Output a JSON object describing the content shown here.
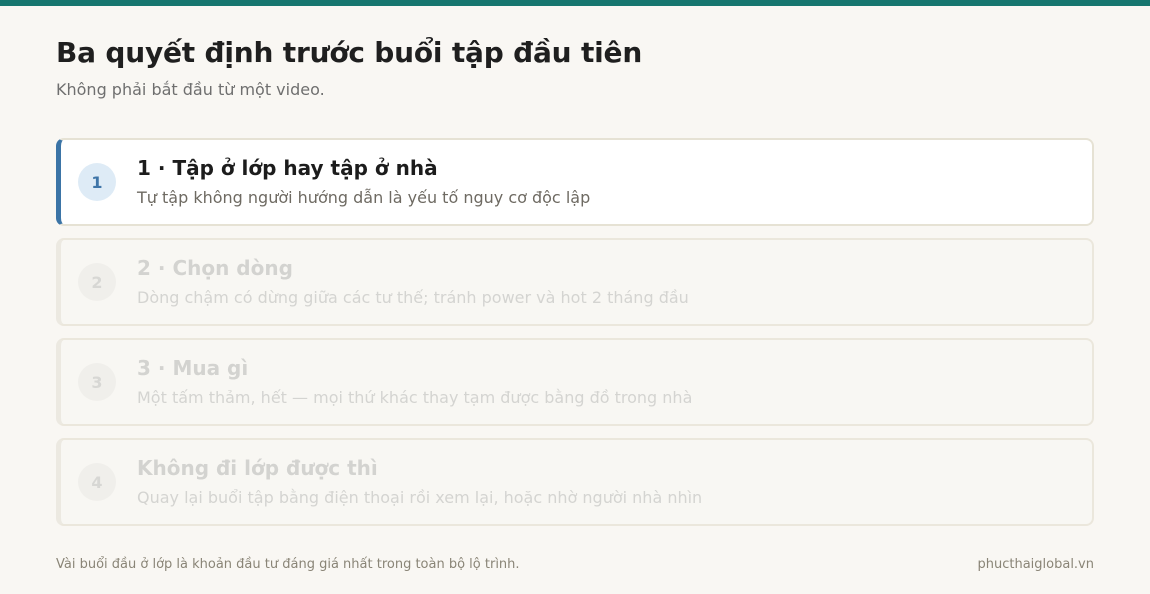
{
  "colors": {
    "accent_bar": "#17766f",
    "active_border": "#3b74a6",
    "background": "#f9f7f3"
  },
  "header": {
    "title": "Ba quyết định trước buổi tập đầu tiên",
    "subtitle": "Không phải bắt đầu từ một video."
  },
  "steps": [
    {
      "number": "1",
      "title": "1 · Tập ở lớp hay tập ở nhà",
      "description": "Tự tập không người hướng dẫn là yếu tố nguy cơ độc lập",
      "state": "active"
    },
    {
      "number": "2",
      "title": "2 · Chọn dòng",
      "description": "Dòng chậm có dừng giữa các tư thế; tránh power và hot 2 tháng đầu",
      "state": "inactive"
    },
    {
      "number": "3",
      "title": "3 · Mua gì",
      "description": "Một tấm thảm, hết — mọi thứ khác thay tạm được bằng đồ trong nhà",
      "state": "inactive"
    },
    {
      "number": "4",
      "title": "Không đi lớp được thì",
      "description": "Quay lại buổi tập bằng điện thoại rồi xem lại, hoặc nhờ người nhà nhìn",
      "state": "inactive"
    }
  ],
  "footer": {
    "note": "Vài buổi đầu ở lớp là khoản đầu tư đáng giá nhất trong toàn bộ lộ trình.",
    "site": "phucthaiglobal.vn"
  }
}
